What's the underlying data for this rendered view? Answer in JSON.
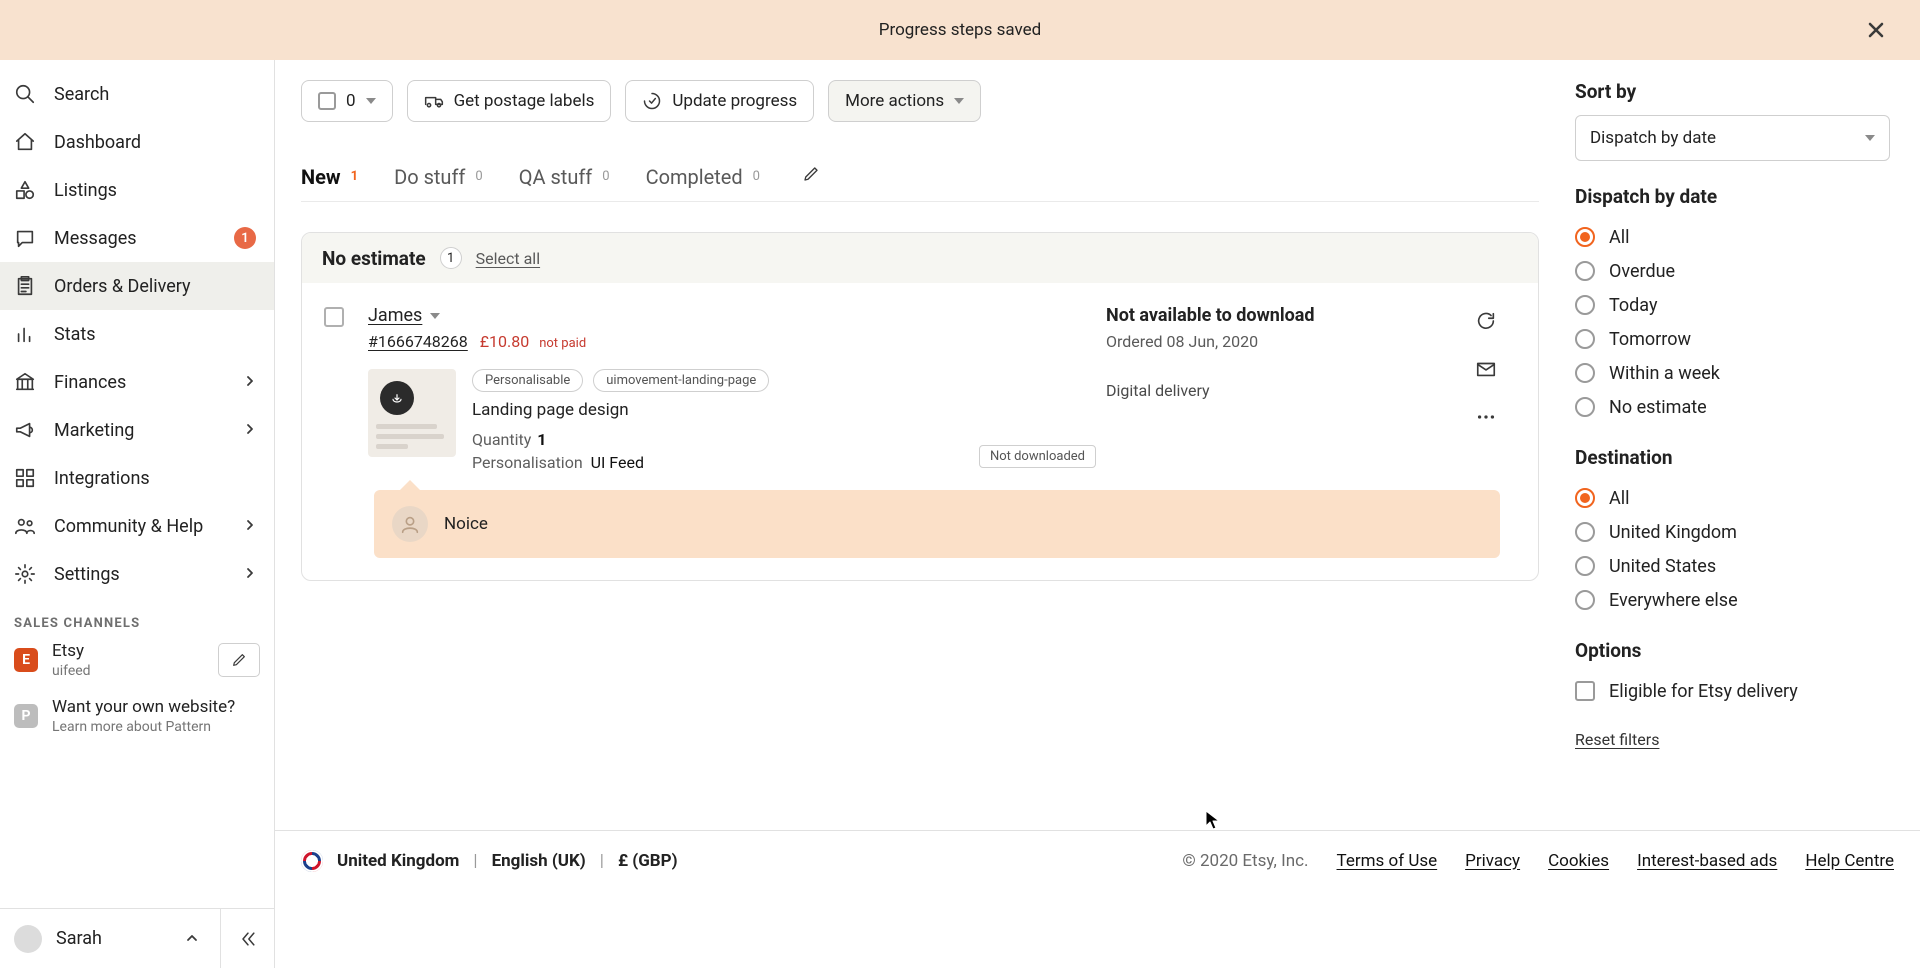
{
  "banner": {
    "message": "Progress steps saved"
  },
  "sidebar": {
    "items": [
      {
        "id": "search",
        "label": "Search"
      },
      {
        "id": "dashboard",
        "label": "Dashboard"
      },
      {
        "id": "listings",
        "label": "Listings"
      },
      {
        "id": "messages",
        "label": "Messages",
        "badge": "1"
      },
      {
        "id": "orders",
        "label": "Orders & Delivery",
        "active": true
      },
      {
        "id": "stats",
        "label": "Stats"
      },
      {
        "id": "finances",
        "label": "Finances",
        "chevron": true
      },
      {
        "id": "marketing",
        "label": "Marketing",
        "chevron": true
      },
      {
        "id": "integrations",
        "label": "Integrations"
      },
      {
        "id": "community",
        "label": "Community & Help",
        "chevron": true
      },
      {
        "id": "settings",
        "label": "Settings",
        "chevron": true
      }
    ],
    "section_label": "SALES CHANNELS",
    "channels": [
      {
        "badge": "E",
        "title": "Etsy",
        "sub": "uifeed",
        "editable": true
      },
      {
        "badge": "P",
        "title": "Want your own website?",
        "sub": "Learn more about Pattern",
        "grey": true
      }
    ],
    "user": {
      "name": "Sarah"
    }
  },
  "toolbar": {
    "selected_count": "0",
    "postage_label": "Get postage labels",
    "update_label": "Update progress",
    "more_label": "More actions"
  },
  "tabs": [
    {
      "label": "New",
      "count": "1",
      "active": true
    },
    {
      "label": "Do stuff",
      "count": "0"
    },
    {
      "label": "QA stuff",
      "count": "0"
    },
    {
      "label": "Completed",
      "count": "0"
    }
  ],
  "group": {
    "title": "No estimate",
    "count": "1",
    "select_all": "Select all"
  },
  "order": {
    "buyer": "James",
    "order_id": "#1666748268",
    "price": "£10.80",
    "not_paid": "not paid",
    "tags": [
      "Personalisable",
      "uimovement-landing-page"
    ],
    "item_title": "Landing page design",
    "qty_label": "Quantity",
    "qty_value": "1",
    "pers_label": "Personalisation",
    "pers_value": "UI Feed",
    "status_title": "Not available to download",
    "ordered": "Ordered 08 Jun, 2020",
    "delivery": "Digital delivery",
    "not_downloaded": "Not downloaded",
    "note": "Noice"
  },
  "filters": {
    "sort_label": "Sort by",
    "sort_value": "Dispatch by date",
    "dispatch_label": "Dispatch by date",
    "dispatch_options": [
      "All",
      "Overdue",
      "Today",
      "Tomorrow",
      "Within a week",
      "No estimate"
    ],
    "dispatch_selected": "All",
    "dest_label": "Destination",
    "dest_options": [
      "All",
      "United Kingdom",
      "United States",
      "Everywhere else"
    ],
    "dest_selected": "All",
    "options_label": "Options",
    "options_check": "Eligible for Etsy delivery",
    "reset": "Reset filters"
  },
  "footer": {
    "country": "United Kingdom",
    "language": "English (UK)",
    "currency": "£ (GBP)",
    "copyright": "© 2020 Etsy, Inc.",
    "links": [
      "Terms of Use",
      "Privacy",
      "Cookies",
      "Interest-based ads",
      "Help Centre"
    ]
  }
}
